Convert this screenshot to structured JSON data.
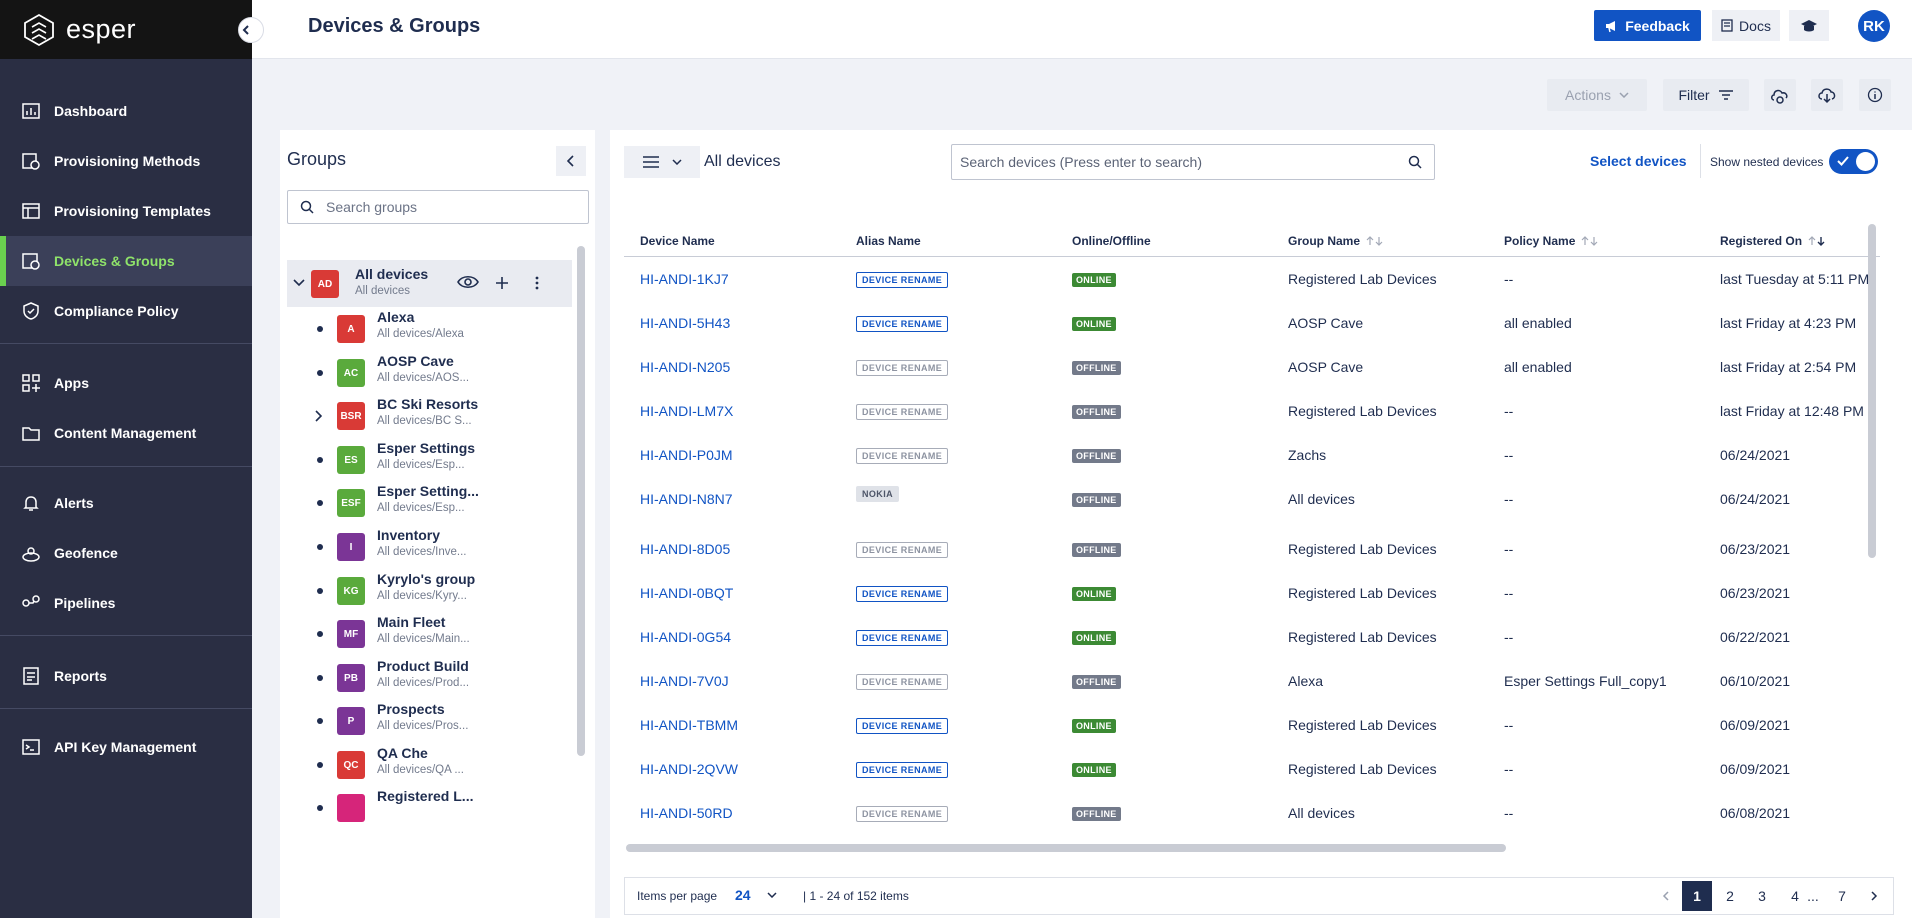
{
  "brand": {
    "name": "esper"
  },
  "sidebar": {
    "items": [
      {
        "label": "Dashboard",
        "icon": "dashboard-icon"
      },
      {
        "label": "Provisioning Methods",
        "icon": "provisioning-methods-icon"
      },
      {
        "label": "Provisioning Templates",
        "icon": "provisioning-templates-icon"
      },
      {
        "label": "Devices & Groups",
        "icon": "devices-groups-icon",
        "active": true
      },
      {
        "label": "Compliance Policy",
        "icon": "shield-icon"
      },
      {
        "label": "Apps",
        "icon": "apps-icon"
      },
      {
        "label": "Content Management",
        "icon": "folder-icon"
      },
      {
        "label": "Alerts",
        "icon": "bell-icon"
      },
      {
        "label": "Geofence",
        "icon": "geofence-icon"
      },
      {
        "label": "Pipelines",
        "icon": "pipelines-icon"
      },
      {
        "label": "Reports",
        "icon": "reports-icon"
      },
      {
        "label": "API Key Management",
        "icon": "terminal-icon"
      }
    ]
  },
  "header": {
    "title": "Devices & Groups",
    "feedback": "Feedback",
    "docs": "Docs",
    "avatar": "RK"
  },
  "toolbar": {
    "actions": "Actions",
    "filter": "Filter"
  },
  "groups": {
    "title": "Groups",
    "search_placeholder": "Search groups",
    "all": {
      "badge": "AD",
      "name": "All devices",
      "path": "All devices"
    },
    "items": [
      {
        "badge": "A",
        "color": "#d93a36",
        "name": "Alexa",
        "path": "All devices/Alexa"
      },
      {
        "badge": "AC",
        "color": "#5aaa3c",
        "name": "AOSP Cave",
        "path": "All devices/AOS..."
      },
      {
        "badge": "BSR",
        "color": "#d93a36",
        "name": "BC Ski Resorts",
        "path": "All devices/BC S...",
        "expandable": true
      },
      {
        "badge": "ES",
        "color": "#5aaa3c",
        "name": "Esper Settings",
        "path": "All devices/Esp..."
      },
      {
        "badge": "ESF",
        "color": "#5aaa3c",
        "name": "Esper Setting...",
        "path": "All devices/Esp..."
      },
      {
        "badge": "I",
        "color": "#7b3596",
        "name": "Inventory",
        "path": "All devices/Inve..."
      },
      {
        "badge": "KG",
        "color": "#5aaa3c",
        "name": "Kyrylo's group",
        "path": "All devices/Kyry..."
      },
      {
        "badge": "MF",
        "color": "#7b3596",
        "name": "Main Fleet",
        "path": "All devices/Main..."
      },
      {
        "badge": "PB",
        "color": "#7b3596",
        "name": "Product Build",
        "path": "All devices/Prod..."
      },
      {
        "badge": "P",
        "color": "#7b3596",
        "name": "Prospects",
        "path": "All devices/Pros..."
      },
      {
        "badge": "QC",
        "color": "#d93a36",
        "name": "QA Che",
        "path": "All devices/QA ..."
      },
      {
        "badge": "",
        "color": "#d6257a",
        "name": "Registered L...",
        "path": ""
      }
    ]
  },
  "devices": {
    "view_title": "All devices",
    "search_placeholder": "Search devices (Press enter to search)",
    "select_devices": "Select devices",
    "show_nested": "Show nested devices",
    "show_nested_on": true,
    "columns": [
      "Device Name",
      "Alias Name",
      "Online/Offline",
      "Group Name",
      "Policy Name",
      "Registered On"
    ],
    "rows": [
      {
        "name": "HI-ANDI-1KJ7",
        "alias": "DEVICE RENAME",
        "alias_style": "b",
        "status": "ONLINE",
        "group": "Registered Lab Devices",
        "policy": "--",
        "registered": "last Tuesday at 5:11 PM"
      },
      {
        "name": "HI-ANDI-5H43",
        "alias": "DEVICE RENAME",
        "alias_style": "b",
        "status": "ONLINE",
        "group": "AOSP Cave",
        "policy": "all enabled",
        "registered": "last Friday at 4:23 PM"
      },
      {
        "name": "HI-ANDI-N205",
        "alias": "DEVICE RENAME",
        "alias_style": "g",
        "status": "OFFLINE",
        "group": "AOSP Cave",
        "policy": "all enabled",
        "registered": "last Friday at 2:54 PM"
      },
      {
        "name": "HI-ANDI-LM7X",
        "alias": "DEVICE RENAME",
        "alias_style": "g",
        "status": "OFFLINE",
        "group": "Registered Lab Devices",
        "policy": "--",
        "registered": "last Friday at 12:48 PM"
      },
      {
        "name": "HI-ANDI-P0JM",
        "alias": "DEVICE RENAME",
        "alias_style": "g",
        "status": "OFFLINE",
        "group": "Zachs",
        "policy": "--",
        "registered": "06/24/2021"
      },
      {
        "name": "HI-ANDI-N8N7",
        "alias": "NOKIA",
        "alias_style": "n",
        "status": "OFFLINE",
        "group": "All devices",
        "policy": "--",
        "registered": "06/24/2021"
      },
      {
        "name": "HI-ANDI-8D05",
        "alias": "DEVICE RENAME",
        "alias_style": "g",
        "status": "OFFLINE",
        "group": "Registered Lab Devices",
        "policy": "--",
        "registered": "06/23/2021"
      },
      {
        "name": "HI-ANDI-0BQT",
        "alias": "DEVICE RENAME",
        "alias_style": "b",
        "status": "ONLINE",
        "group": "Registered Lab Devices",
        "policy": "--",
        "registered": "06/23/2021"
      },
      {
        "name": "HI-ANDI-0G54",
        "alias": "DEVICE RENAME",
        "alias_style": "b",
        "status": "ONLINE",
        "group": "Registered Lab Devices",
        "policy": "--",
        "registered": "06/22/2021"
      },
      {
        "name": "HI-ANDI-7V0J",
        "alias": "DEVICE RENAME",
        "alias_style": "g",
        "status": "OFFLINE",
        "group": "Alexa",
        "policy": "Esper Settings Full_copy1",
        "registered": "06/10/2021"
      },
      {
        "name": "HI-ANDI-TBMM",
        "alias": "DEVICE RENAME",
        "alias_style": "b",
        "status": "ONLINE",
        "group": "Registered Lab Devices",
        "policy": "--",
        "registered": "06/09/2021"
      },
      {
        "name": "HI-ANDI-2QVW",
        "alias": "DEVICE RENAME",
        "alias_style": "b",
        "status": "ONLINE",
        "group": "Registered Lab Devices",
        "policy": "--",
        "registered": "06/09/2021"
      },
      {
        "name": "HI-ANDI-50RD",
        "alias": "DEVICE RENAME",
        "alias_style": "g",
        "status": "OFFLINE",
        "group": "All devices",
        "policy": "--",
        "registered": "06/08/2021"
      }
    ]
  },
  "pagination": {
    "items_per_page_label": "Items per page",
    "items_per_page": "24",
    "range": "| 1 - 24 of 152 items",
    "pages": [
      "1",
      "2",
      "3",
      "4",
      "...",
      "7"
    ],
    "current": "1"
  },
  "colors": {
    "accent": "#1154c4",
    "sidebar": "#2a2e43",
    "active_nav": "#8fe36a",
    "online": "#3c8a34",
    "offline": "#737a8a"
  }
}
